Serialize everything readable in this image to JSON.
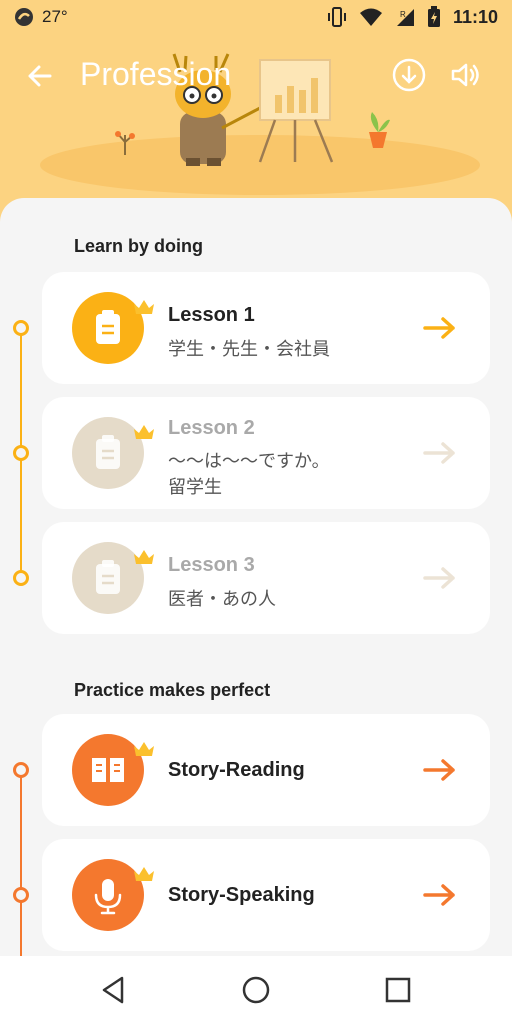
{
  "status_bar": {
    "temperature": "27°",
    "time": "11:10"
  },
  "header": {
    "title": "Profession"
  },
  "sections": {
    "learn": {
      "title": "Learn by doing",
      "lessons": [
        {
          "title": "Lesson 1",
          "subtitle_line1": "学生・先生・会社員",
          "subtitle_line2": ""
        },
        {
          "title": "Lesson 2",
          "subtitle_line1": "～～は～～ですか。",
          "subtitle_line2": "留学生"
        },
        {
          "title": "Lesson 3",
          "subtitle_line1": "医者・あの人",
          "subtitle_line2": ""
        }
      ]
    },
    "practice": {
      "title": "Practice makes perfect",
      "items": [
        {
          "title": "Story-Reading"
        },
        {
          "title": "Story-Speaking"
        }
      ]
    }
  },
  "icons": {
    "back": "back-arrow-icon",
    "download": "download-icon",
    "sound": "speaker-icon",
    "lesson": "clipboard-icon",
    "crown": "crown-icon",
    "reading": "book-icon",
    "speaking": "microphone-icon"
  },
  "colors": {
    "header_bg": "#fcd381",
    "active_yellow": "#fbb115",
    "inactive_beige": "#e5dbc9",
    "practice_orange": "#f4782e",
    "crown": "#fbc02d"
  }
}
